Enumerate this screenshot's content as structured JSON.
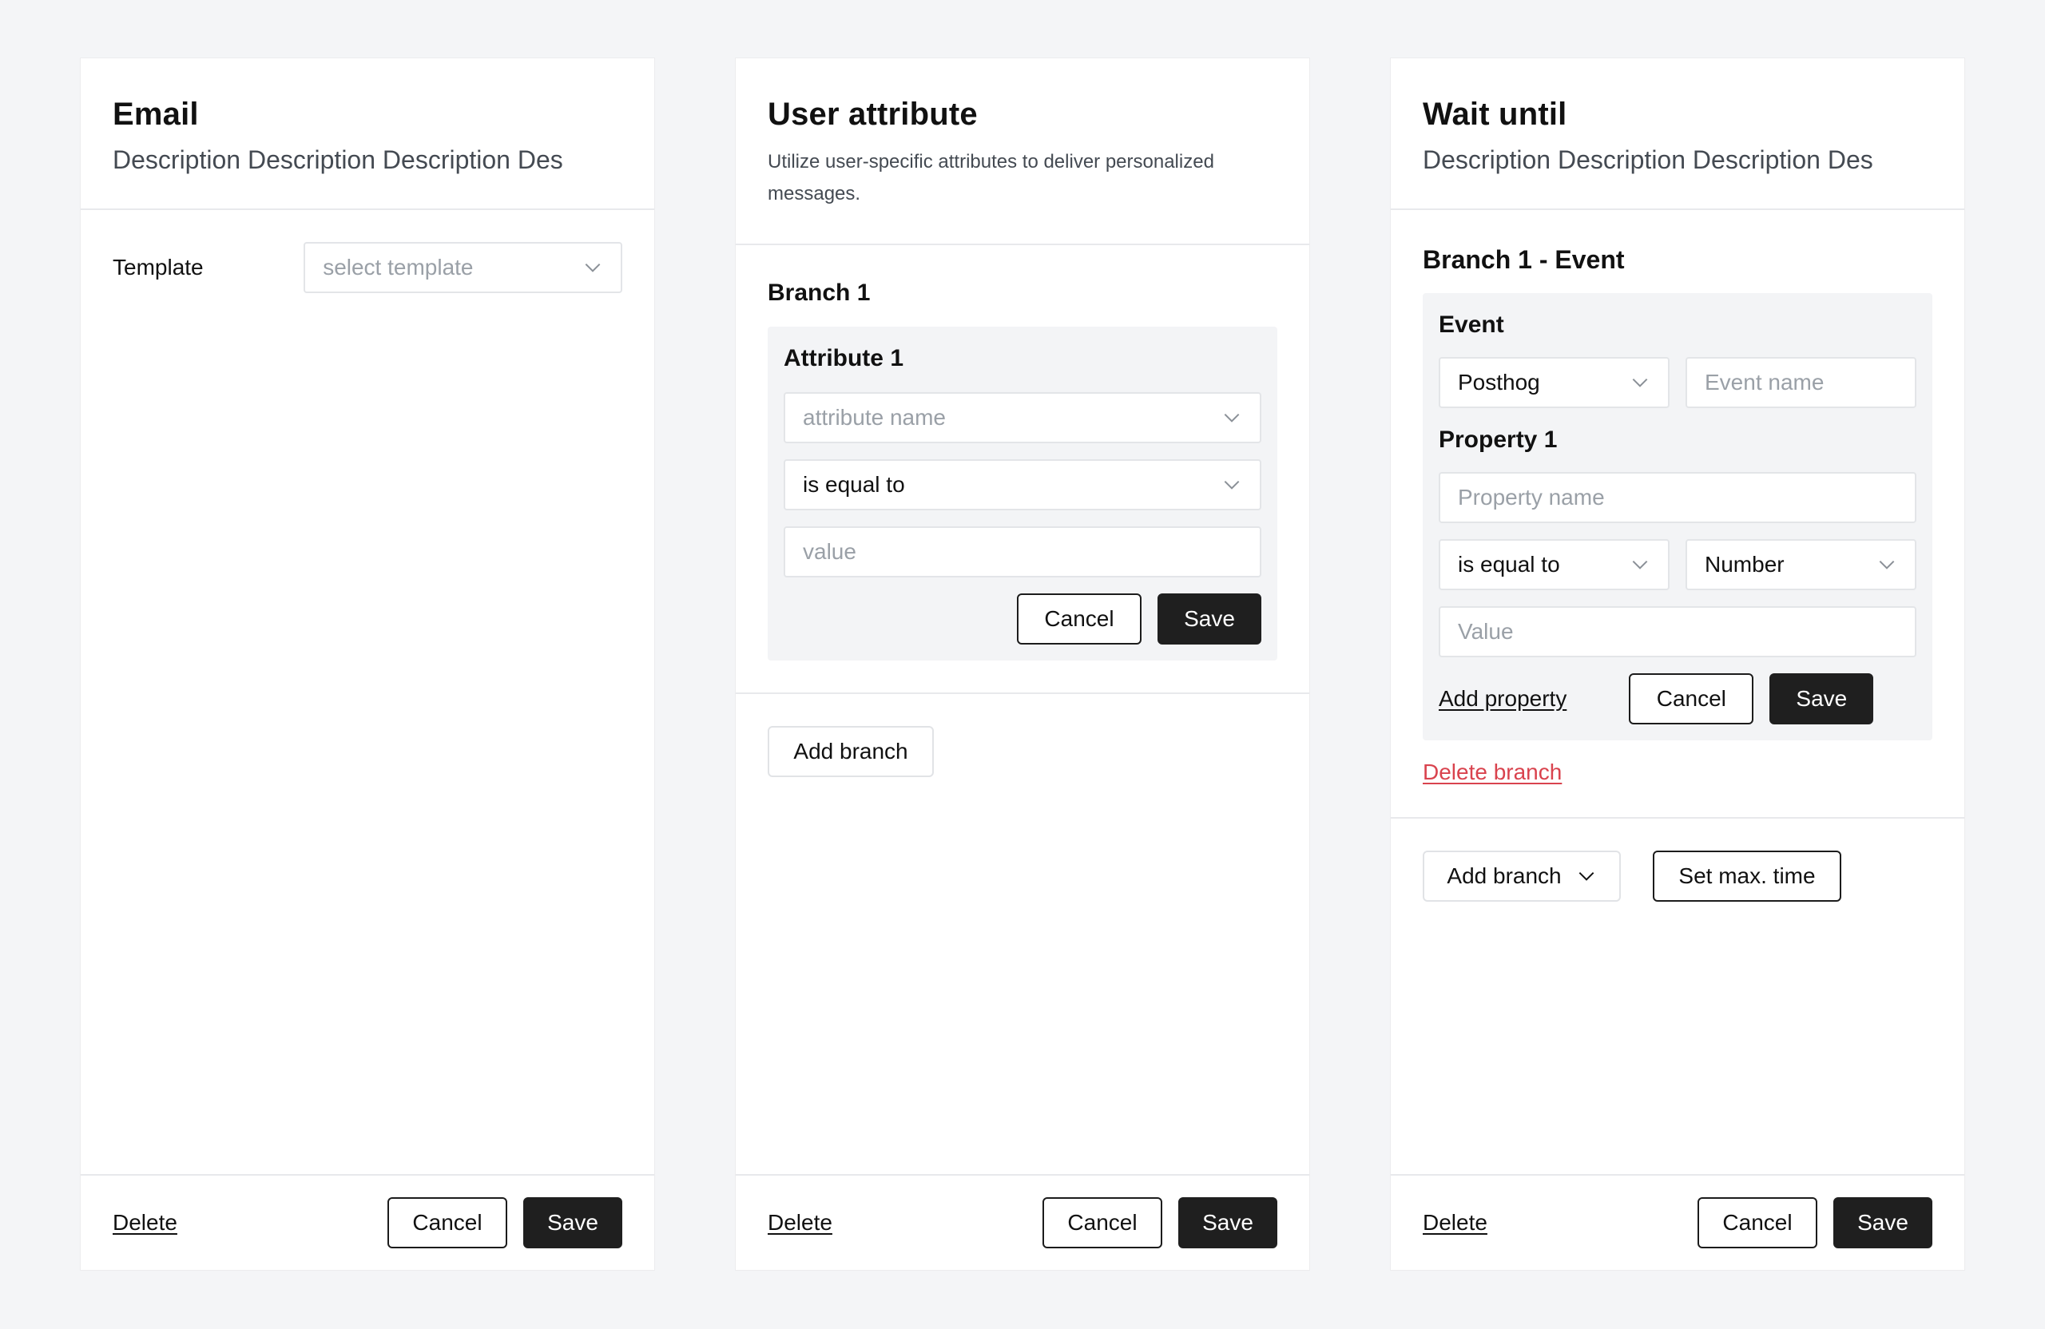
{
  "email": {
    "title": "Email",
    "description": "Description Description Description Des",
    "template_label": "Template",
    "template_placeholder": "select template",
    "footer": {
      "delete": "Delete",
      "cancel": "Cancel",
      "save": "Save"
    }
  },
  "user_attribute": {
    "title": "User attribute",
    "description": "Utilize user-specific attributes to deliver personalized messages.",
    "branch_title": "Branch 1",
    "attribute_title": "Attribute 1",
    "attribute_name_placeholder": "attribute name",
    "operator_value": "is equal to",
    "value_placeholder": "value",
    "cancel": "Cancel",
    "save": "Save",
    "add_branch": "Add branch",
    "footer": {
      "delete": "Delete",
      "cancel": "Cancel",
      "save": "Save"
    }
  },
  "wait_until": {
    "title": "Wait until",
    "description": "Description Description Description Des",
    "branch_title": "Branch 1 - Event",
    "event_label": "Event",
    "event_source": "Posthog",
    "event_name_placeholder": "Event name",
    "property_title": "Property 1",
    "property_name_placeholder": "Property name",
    "operator_value": "is equal to",
    "type_value": "Number",
    "value_placeholder": "Value",
    "add_property": "Add property",
    "cancel": "Cancel",
    "save": "Save",
    "delete_branch": "Delete branch",
    "add_branch": "Add branch",
    "set_max_time": "Set max. time",
    "footer": {
      "delete": "Delete",
      "cancel": "Cancel",
      "save": "Save"
    }
  },
  "colors": {
    "background": "#f4f5f7",
    "panel": "#ffffff",
    "primary_button": "#1f1f1f",
    "danger": "#d9434e",
    "field_group": "#f3f4f6"
  }
}
